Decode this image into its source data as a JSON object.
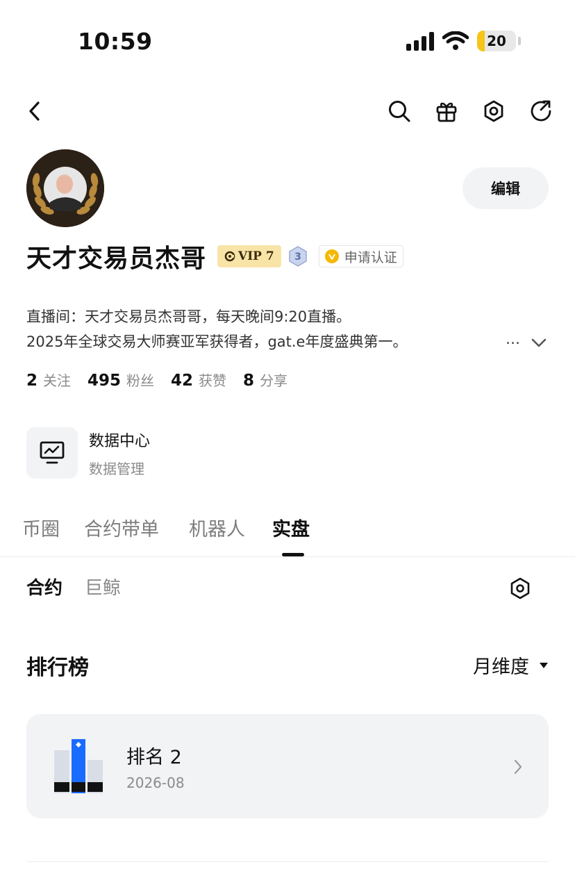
{
  "status_bar": {
    "time": "10:59",
    "battery_level": "20",
    "battery_color": "#f5c518"
  },
  "nav": {
    "back_icon": "chevron-left-icon",
    "actions": [
      "search-icon",
      "gift-icon",
      "settings-icon",
      "share-icon"
    ]
  },
  "profile": {
    "name": "天才交易员杰哥",
    "vip": "VIP 7",
    "level": "3",
    "verify": "申请认证",
    "edit": "编辑",
    "bio_line1": "直播间：天才交易员杰哥哥，每天晚间9:20直播。",
    "bio_line2": "2025年全球交易大师赛亚军获得者，gat.e年度盛典第一。",
    "bio_more": "…"
  },
  "stats": [
    {
      "num": "2",
      "label": "关注"
    },
    {
      "num": "495",
      "label": "粉丝"
    },
    {
      "num": "42",
      "label": "获赞"
    },
    {
      "num": "8",
      "label": "分享"
    }
  ],
  "data_center": {
    "title": "数据中心",
    "subtitle": "数据管理"
  },
  "tabs": [
    "币圈",
    "合约带单",
    "机器人",
    "实盘"
  ],
  "active_tab": "实盘",
  "subtabs": [
    "合约",
    "巨鲸"
  ],
  "ranking": {
    "title": "排行榜",
    "filter": "月维度",
    "label": "排名 2",
    "date": "2026-08",
    "accent": "#1a6bff"
  }
}
